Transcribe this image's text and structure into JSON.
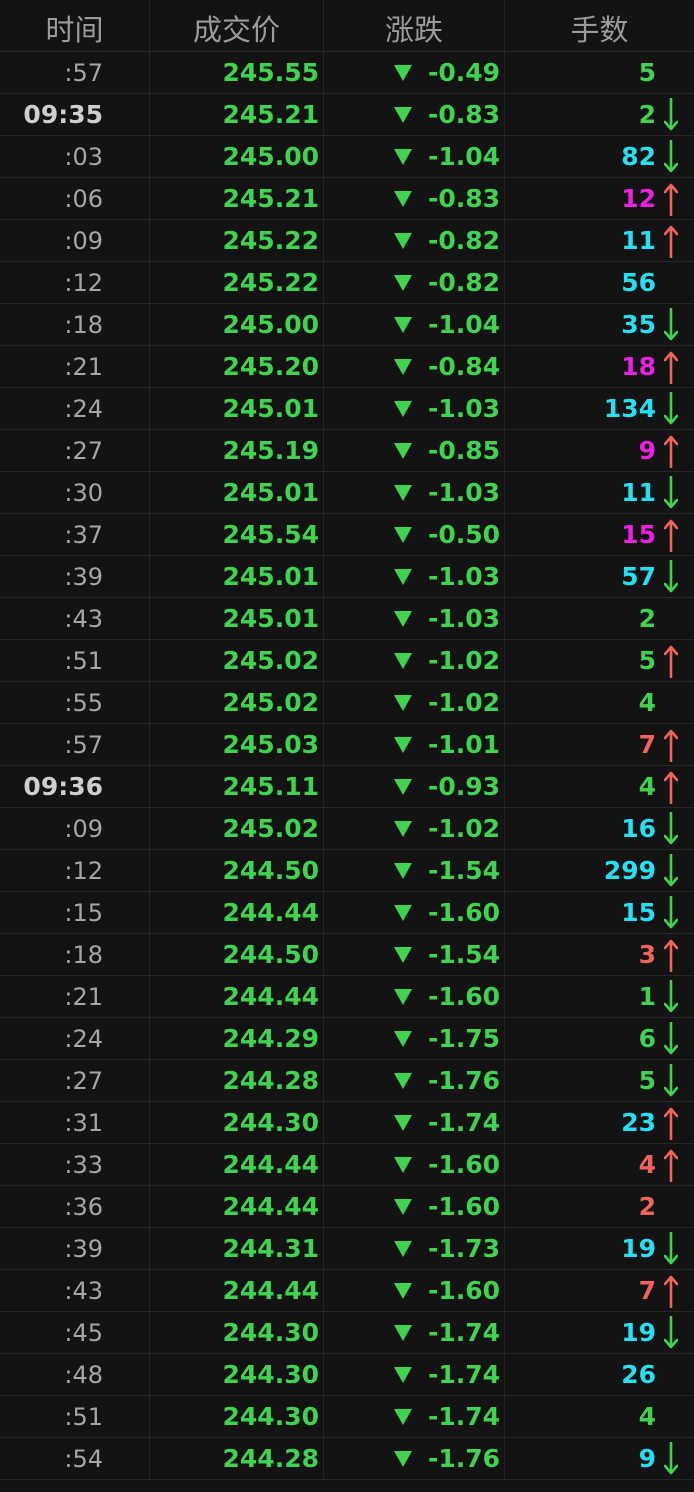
{
  "header": {
    "time": "时间",
    "price": "成交价",
    "change": "涨跌",
    "volume": "手数"
  },
  "colors": {
    "green": "#3fd34f",
    "cyan": "#25e0f0",
    "magenta": "#ec1fe2",
    "red": "#f0645a",
    "arrow_up": "#f0645a",
    "arrow_down": "#3fd34f"
  },
  "rows": [
    {
      "time": ":57",
      "bold": false,
      "price": "245.55",
      "change": "-0.49",
      "volume": "5",
      "vol_color": "green",
      "arrow": "none"
    },
    {
      "time": "09:35",
      "bold": true,
      "price": "245.21",
      "change": "-0.83",
      "volume": "2",
      "vol_color": "green",
      "arrow": "down"
    },
    {
      "time": ":03",
      "bold": false,
      "price": "245.00",
      "change": "-1.04",
      "volume": "82",
      "vol_color": "cyan",
      "arrow": "down"
    },
    {
      "time": ":06",
      "bold": false,
      "price": "245.21",
      "change": "-0.83",
      "volume": "12",
      "vol_color": "magenta",
      "arrow": "up"
    },
    {
      "time": ":09",
      "bold": false,
      "price": "245.22",
      "change": "-0.82",
      "volume": "11",
      "vol_color": "cyan",
      "arrow": "up"
    },
    {
      "time": ":12",
      "bold": false,
      "price": "245.22",
      "change": "-0.82",
      "volume": "56",
      "vol_color": "cyan",
      "arrow": "none"
    },
    {
      "time": ":18",
      "bold": false,
      "price": "245.00",
      "change": "-1.04",
      "volume": "35",
      "vol_color": "cyan",
      "arrow": "down"
    },
    {
      "time": ":21",
      "bold": false,
      "price": "245.20",
      "change": "-0.84",
      "volume": "18",
      "vol_color": "magenta",
      "arrow": "up"
    },
    {
      "time": ":24",
      "bold": false,
      "price": "245.01",
      "change": "-1.03",
      "volume": "134",
      "vol_color": "cyan",
      "arrow": "down"
    },
    {
      "time": ":27",
      "bold": false,
      "price": "245.19",
      "change": "-0.85",
      "volume": "9",
      "vol_color": "magenta",
      "arrow": "up"
    },
    {
      "time": ":30",
      "bold": false,
      "price": "245.01",
      "change": "-1.03",
      "volume": "11",
      "vol_color": "cyan",
      "arrow": "down"
    },
    {
      "time": ":37",
      "bold": false,
      "price": "245.54",
      "change": "-0.50",
      "volume": "15",
      "vol_color": "magenta",
      "arrow": "up"
    },
    {
      "time": ":39",
      "bold": false,
      "price": "245.01",
      "change": "-1.03",
      "volume": "57",
      "vol_color": "cyan",
      "arrow": "down"
    },
    {
      "time": ":43",
      "bold": false,
      "price": "245.01",
      "change": "-1.03",
      "volume": "2",
      "vol_color": "green",
      "arrow": "none"
    },
    {
      "time": ":51",
      "bold": false,
      "price": "245.02",
      "change": "-1.02",
      "volume": "5",
      "vol_color": "green",
      "arrow": "up"
    },
    {
      "time": ":55",
      "bold": false,
      "price": "245.02",
      "change": "-1.02",
      "volume": "4",
      "vol_color": "green",
      "arrow": "none"
    },
    {
      "time": ":57",
      "bold": false,
      "price": "245.03",
      "change": "-1.01",
      "volume": "7",
      "vol_color": "red",
      "arrow": "up"
    },
    {
      "time": "09:36",
      "bold": true,
      "price": "245.11",
      "change": "-0.93",
      "volume": "4",
      "vol_color": "green",
      "arrow": "up"
    },
    {
      "time": ":09",
      "bold": false,
      "price": "245.02",
      "change": "-1.02",
      "volume": "16",
      "vol_color": "cyan",
      "arrow": "down"
    },
    {
      "time": ":12",
      "bold": false,
      "price": "244.50",
      "change": "-1.54",
      "volume": "299",
      "vol_color": "cyan",
      "arrow": "down"
    },
    {
      "time": ":15",
      "bold": false,
      "price": "244.44",
      "change": "-1.60",
      "volume": "15",
      "vol_color": "cyan",
      "arrow": "down"
    },
    {
      "time": ":18",
      "bold": false,
      "price": "244.50",
      "change": "-1.54",
      "volume": "3",
      "vol_color": "red",
      "arrow": "up"
    },
    {
      "time": ":21",
      "bold": false,
      "price": "244.44",
      "change": "-1.60",
      "volume": "1",
      "vol_color": "green",
      "arrow": "down"
    },
    {
      "time": ":24",
      "bold": false,
      "price": "244.29",
      "change": "-1.75",
      "volume": "6",
      "vol_color": "green",
      "arrow": "down"
    },
    {
      "time": ":27",
      "bold": false,
      "price": "244.28",
      "change": "-1.76",
      "volume": "5",
      "vol_color": "green",
      "arrow": "down"
    },
    {
      "time": ":31",
      "bold": false,
      "price": "244.30",
      "change": "-1.74",
      "volume": "23",
      "vol_color": "cyan",
      "arrow": "up"
    },
    {
      "time": ":33",
      "bold": false,
      "price": "244.44",
      "change": "-1.60",
      "volume": "4",
      "vol_color": "red",
      "arrow": "up"
    },
    {
      "time": ":36",
      "bold": false,
      "price": "244.44",
      "change": "-1.60",
      "volume": "2",
      "vol_color": "red",
      "arrow": "none"
    },
    {
      "time": ":39",
      "bold": false,
      "price": "244.31",
      "change": "-1.73",
      "volume": "19",
      "vol_color": "cyan",
      "arrow": "down"
    },
    {
      "time": ":43",
      "bold": false,
      "price": "244.44",
      "change": "-1.60",
      "volume": "7",
      "vol_color": "red",
      "arrow": "up"
    },
    {
      "time": ":45",
      "bold": false,
      "price": "244.30",
      "change": "-1.74",
      "volume": "19",
      "vol_color": "cyan",
      "arrow": "down"
    },
    {
      "time": ":48",
      "bold": false,
      "price": "244.30",
      "change": "-1.74",
      "volume": "26",
      "vol_color": "cyan",
      "arrow": "none"
    },
    {
      "time": ":51",
      "bold": false,
      "price": "244.30",
      "change": "-1.74",
      "volume": "4",
      "vol_color": "green",
      "arrow": "none"
    },
    {
      "time": ":54",
      "bold": false,
      "price": "244.28",
      "change": "-1.76",
      "volume": "9",
      "vol_color": "cyan",
      "arrow": "down"
    }
  ]
}
